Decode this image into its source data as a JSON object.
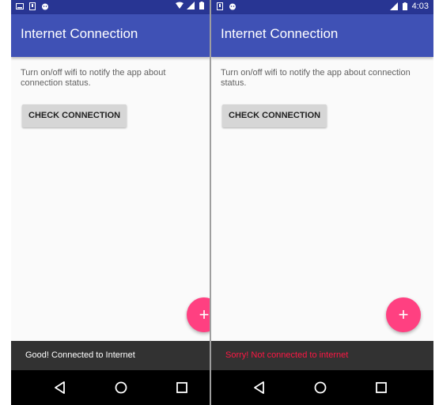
{
  "left": {
    "status": {
      "time": ""
    },
    "app_title": "Internet Connection",
    "body": "Turn on/off wifi to notify the app about connection status.",
    "button": "CHECK CONNECTION",
    "fab": "+",
    "snackbar": {
      "message": "Good! Connected to Internet",
      "color": "#ffffff"
    }
  },
  "right": {
    "status": {
      "time": "4:03"
    },
    "app_title": "Internet Connection",
    "body": "Turn on/off wifi to notify the app about connection status.",
    "button": "CHECK CONNECTION",
    "fab": "+",
    "snackbar": {
      "message": "Sorry! Not connected to internet",
      "color": "#ff1744"
    }
  },
  "colors": {
    "primary": "#3f51b5",
    "primary_dark": "#283593",
    "accent": "#ff4081",
    "snackbar_bg": "#323232"
  },
  "icons": {
    "status_left": [
      "screenshot-icon",
      "download-icon",
      "android-icon"
    ],
    "status_right_left_phone": [
      "wifi-icon",
      "signal-icon",
      "battery-icon"
    ],
    "status_right_right_phone": [
      "signal-icon",
      "battery-icon"
    ],
    "nav": [
      "back-icon",
      "home-icon",
      "recents-icon"
    ]
  }
}
